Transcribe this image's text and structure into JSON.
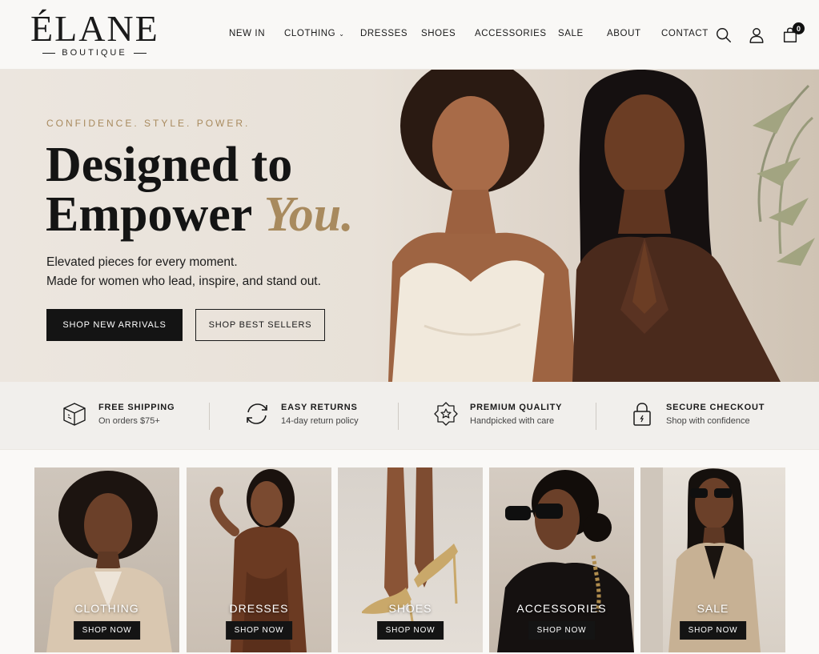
{
  "brand": {
    "name": "ÉLANE",
    "tagline": "BOUTIQUE"
  },
  "nav": {
    "items": [
      {
        "label": "NEW IN"
      },
      {
        "label": "CLOTHING",
        "has_dropdown": true
      },
      {
        "label": "DRESSES"
      },
      {
        "label": "SHOES"
      },
      {
        "label": "ACCESSORIES"
      },
      {
        "label": "SALE"
      },
      {
        "label": "ABOUT"
      },
      {
        "label": "CONTACT"
      }
    ],
    "icons": [
      "search-icon",
      "user-icon",
      "shopping-bag-icon"
    ],
    "cart_count": "0"
  },
  "hero": {
    "eyebrow": "CONFIDENCE. STYLE. POWER.",
    "title_line1": "Designed to",
    "title_line2": "Empower",
    "title_accent": "You.",
    "subtitle_line1": "Elevated pieces for every moment.",
    "subtitle_line2": "Made for women who lead, inspire, and stand out.",
    "primary_cta": "SHOP NEW ARRIVALS",
    "secondary_cta": "SHOP BEST SELLERS"
  },
  "features": [
    {
      "icon": "box-icon",
      "title": "FREE SHIPPING",
      "subtitle": "On orders $75+"
    },
    {
      "icon": "refresh-icon",
      "title": "EASY RETURNS",
      "subtitle": "14-day return policy"
    },
    {
      "icon": "star-badge-icon",
      "title": "PREMIUM QUALITY",
      "subtitle": "Handpicked with care"
    },
    {
      "icon": "lock-icon",
      "title": "SECURE CHECKOUT",
      "subtitle": "Shop with confidence"
    }
  ],
  "categories": [
    {
      "label": "CLOTHING",
      "cta": "SHOP NOW"
    },
    {
      "label": "DRESSES",
      "cta": "SHOP NOW"
    },
    {
      "label": "SHOES",
      "cta": "SHOP NOW"
    },
    {
      "label": "ACCESSORIES",
      "cta": "SHOP NOW"
    },
    {
      "label": "SALE",
      "cta": "SHOP NOW"
    }
  ],
  "colors": {
    "accent_gold": "#a88a5e",
    "dark": "#141414",
    "hero_bg": "#e8e1d8",
    "feature_bg": "#f1efec"
  }
}
